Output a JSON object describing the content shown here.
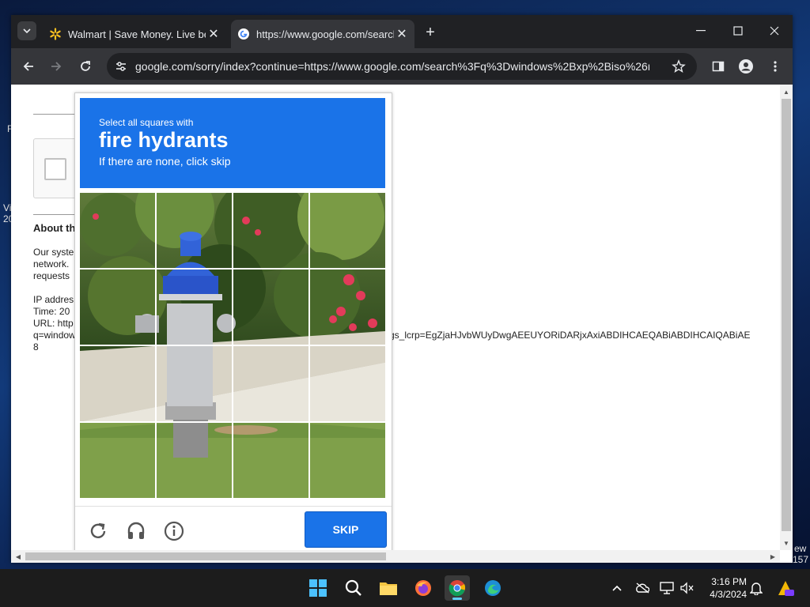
{
  "desktop": {
    "left_fragments": [
      "F",
      "Vi",
      "20"
    ],
    "right_fragments": [
      "ew",
      "157"
    ]
  },
  "browser": {
    "tabs": [
      {
        "title": "Walmart | Save Money. Live bet",
        "active": false,
        "icon": "walmart-spark-icon"
      },
      {
        "title": "https://www.google.com/search",
        "active": true,
        "icon": "google-g-icon"
      }
    ],
    "address": "google.com/sorry/index?continue=https://www.google.com/search%3Fq%3Dwindows%2Bxp%2Biso%26rlz...",
    "accent": "#1a73e8"
  },
  "page": {
    "about_heading": "About th",
    "body_lines": [
      "Our syste",
      "network.",
      "requests"
    ],
    "ip_label": "IP addres",
    "time_label": "Time: 20",
    "url_label": "URL: http",
    "url_cont": "q=window",
    "url_end": "8",
    "url_tail": "gs_lcrp=EgZjaHJvbWUyDwgAEEUYORiDARjxAxiABDIHCAEQABiABDIHCAIQABiAE"
  },
  "captcha": {
    "instruction_prefix": "Select all squares with",
    "target": "fire hydrants",
    "hint": "If there are none, click skip",
    "skip_label": "SKIP",
    "grid_rows": 4,
    "grid_cols": 4
  },
  "taskbar": {
    "time": "3:16 PM",
    "date": "4/3/2024"
  }
}
